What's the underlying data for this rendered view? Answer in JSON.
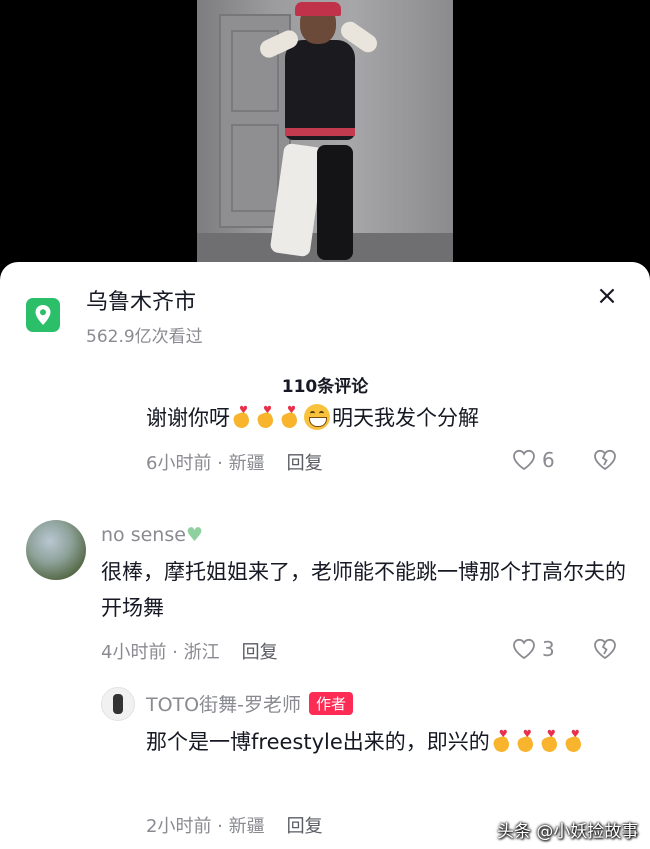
{
  "location": {
    "title": "乌鲁木齐市",
    "views": "562.9亿次看过",
    "icon": "location-pin-icon",
    "icon_color": "#2bbf6a"
  },
  "close_label": "×",
  "comments_count": "110条评论",
  "comment1": {
    "text_a": "谢谢你呀",
    "text_b": "明天我发个分解",
    "time": "6小时前",
    "region": "新疆",
    "reply": "回复",
    "likes": "6"
  },
  "comment2": {
    "user": "no sense",
    "text": "很棒，摩托姐姐来了，老师能不能跳一博那个打高尔夫的开场舞",
    "time": "4小时前",
    "region": "浙江",
    "reply": "回复",
    "likes": "3"
  },
  "reply1": {
    "user": "TOTO街舞-罗老师",
    "badge": "作者",
    "text": "那个是一博freestyle出来的，即兴的",
    "time": "2小时前",
    "region": "新疆",
    "reply": "回复"
  },
  "watermark": "头条 @小妖捡故事",
  "colors": {
    "accent": "#fe2c55",
    "meta": "#8a8b91"
  }
}
